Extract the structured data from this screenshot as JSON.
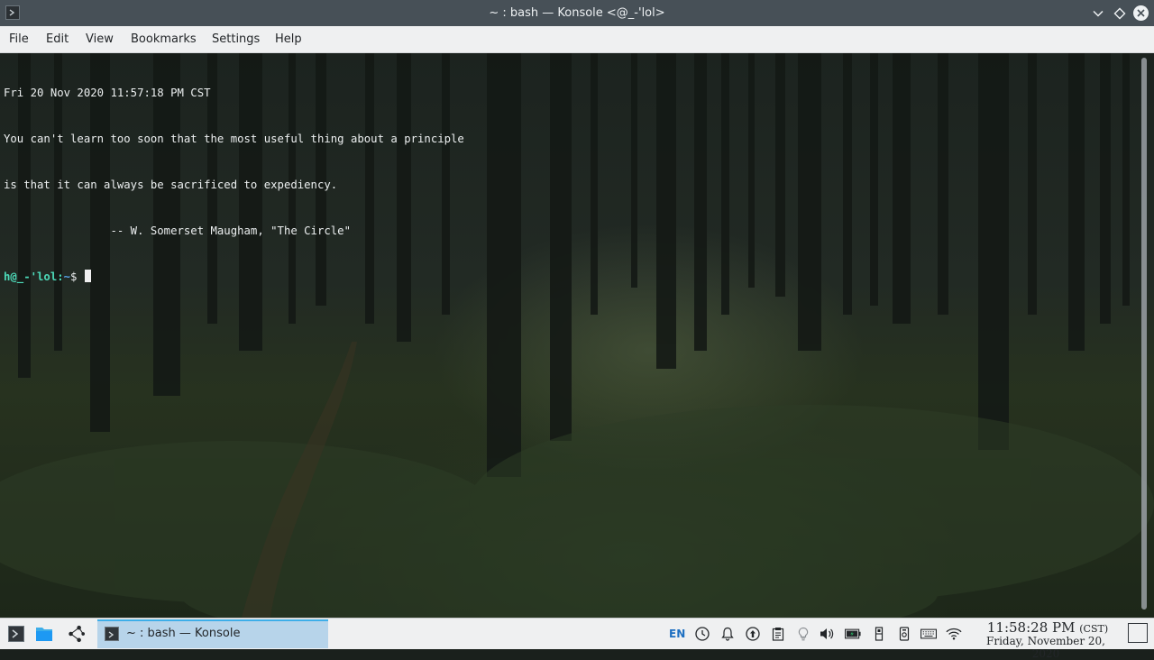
{
  "window": {
    "title": "~ : bash — Konsole <@_-'lol>"
  },
  "menu": {
    "file": "File",
    "edit": "Edit",
    "view": "View",
    "bookmarks": "Bookmarks",
    "settings": "Settings",
    "help": "Help"
  },
  "terminal": {
    "line1": "Fri 20 Nov 2020 11:57:18 PM CST",
    "line2": "You can't learn too soon that the most useful thing about a principle",
    "line3": "is that it can always be sacrificed to expediency.",
    "line4": "                -- W. Somerset Maugham, \"The Circle\"",
    "prompt_user": "h@_-'lol:",
    "prompt_path": "~",
    "prompt_symbol": "$ "
  },
  "taskbar": {
    "task_label": "~ : bash — Konsole",
    "language": "EN",
    "clock_time": "11:58:28 PM",
    "clock_zone": "(CST)",
    "clock_date": "Friday, November 20, 2020"
  },
  "icons": {
    "app": "terminal-icon",
    "minimize": "chevron-down-icon",
    "keep_above": "diamond-icon",
    "close": "close-icon",
    "launcher": "terminal-icon",
    "files": "folder-icon",
    "kde_connect": "share-icon",
    "tray": [
      "clock-icon",
      "bell-icon",
      "update-icon",
      "clipboard-icon",
      "bulb-icon",
      "volume-icon",
      "battery-icon",
      "usb-icon",
      "device-icon",
      "keyboard-icon",
      "wifi-icon"
    ]
  },
  "colors": {
    "titlebar": "#475057",
    "prompt_user": "#4cd9b8",
    "prompt_path": "#56a3e9",
    "task_highlight": "#b7d4ea",
    "accent": "#3daee9"
  }
}
